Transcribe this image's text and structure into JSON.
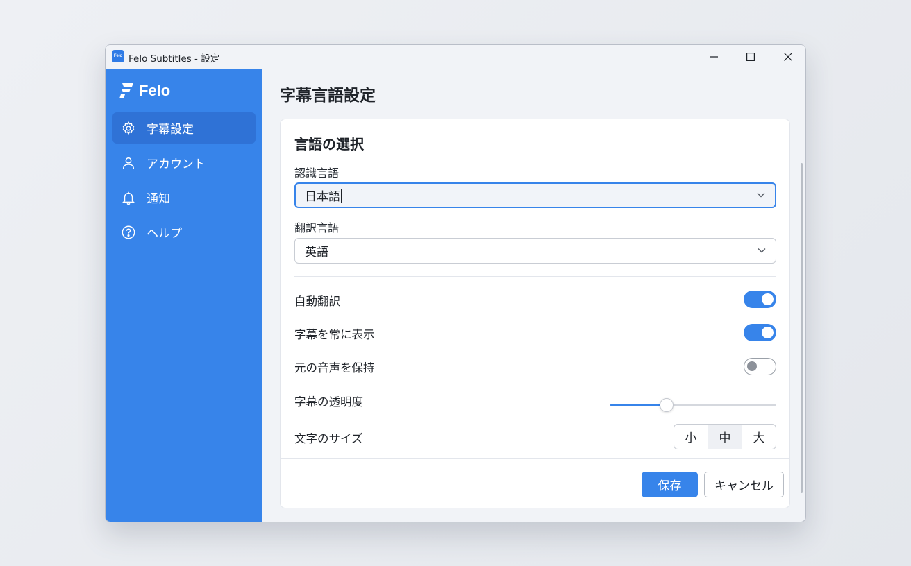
{
  "window": {
    "title": "Felo Subtitles - 設定",
    "app_icon_text": "Felo"
  },
  "sidebar": {
    "brand": "Felo",
    "items": [
      {
        "label": "字幕設定",
        "icon": "gear-icon",
        "active": true
      },
      {
        "label": "アカウント",
        "icon": "user-icon",
        "active": false
      },
      {
        "label": "通知",
        "icon": "bell-icon",
        "active": false
      },
      {
        "label": "ヘルプ",
        "icon": "help-icon",
        "active": false
      }
    ]
  },
  "main": {
    "page_title": "字幕言語設定",
    "section_title": "言語の選択",
    "recognition": {
      "label": "認識言語",
      "value": "日本語"
    },
    "translation": {
      "label": "翻訳言語",
      "value": "英語"
    },
    "toggles": [
      {
        "label": "自動翻訳",
        "on": true
      },
      {
        "label": "字幕を常に表示",
        "on": true
      },
      {
        "label": "元の音声を保持",
        "on": false
      }
    ],
    "opacity": {
      "label": "字幕の透明度",
      "value_percent": 34
    },
    "font_size": {
      "label": "文字のサイズ",
      "options": [
        "小",
        "中",
        "大"
      ],
      "selected": "中"
    },
    "save_label": "保存",
    "cancel_label": "キャンセル"
  },
  "colors": {
    "accent": "#3784ea",
    "sidebar": "#3784ea",
    "sidebar_active": "#2f72d6"
  }
}
